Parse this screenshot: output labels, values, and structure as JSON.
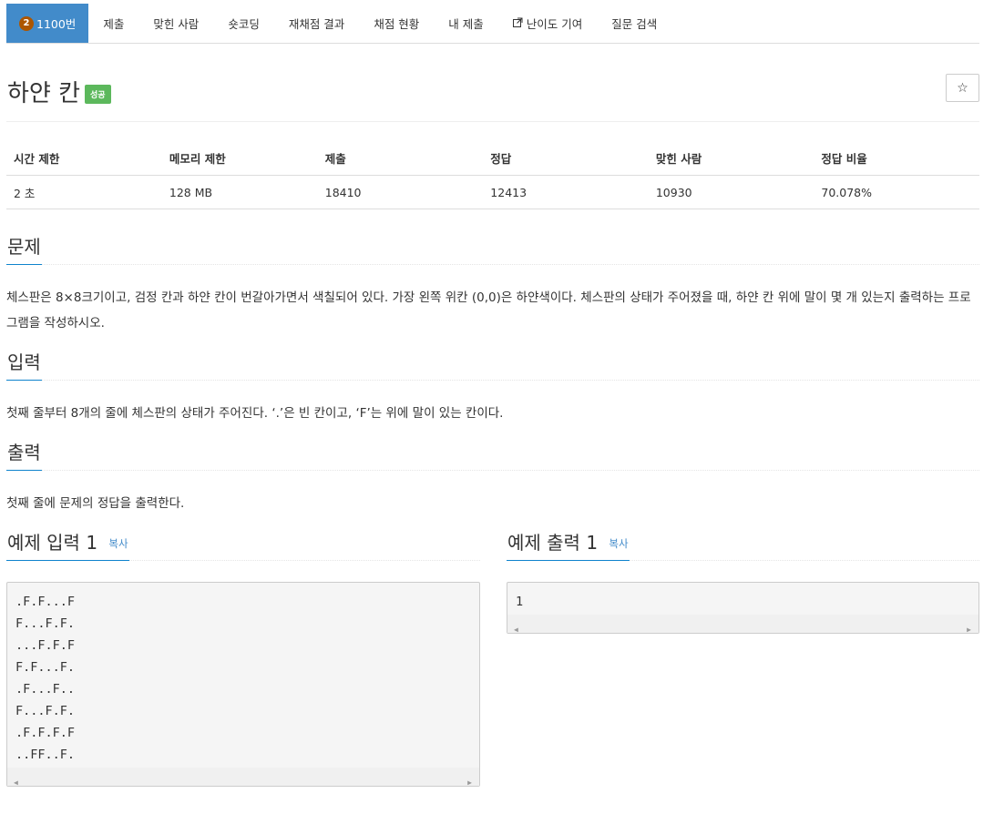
{
  "nav": {
    "problem_number": "1100번",
    "badge": "2",
    "tabs": [
      "제출",
      "맞힌 사람",
      "숏코딩",
      "재채점 결과",
      "채점 현황",
      "내 제출",
      "난이도 기여",
      "질문 검색"
    ]
  },
  "title": "하얀 칸",
  "status_badge": "성공",
  "star": "☆",
  "info_table": {
    "headers": [
      "시간 제한",
      "메모리 제한",
      "제출",
      "정답",
      "맞힌 사람",
      "정답 비율"
    ],
    "values": [
      "2 초",
      "128 MB",
      "18410",
      "12413",
      "10930",
      "70.078%"
    ]
  },
  "sections": {
    "problem": {
      "heading": "문제",
      "text": "체스판은 8×8크기이고, 검정 칸과 하얀 칸이 번갈아가면서 색칠되어 있다. 가장 왼쪽 위칸 (0,0)은 하얀색이다. 체스판의 상태가 주어졌을 때, 하얀 칸 위에 말이 몇 개 있는지 출력하는 프로그램을 작성하시오."
    },
    "input": {
      "heading": "입력",
      "text": "첫째 줄부터 8개의 줄에 체스판의 상태가 주어진다. ‘.’은 빈 칸이고, ‘F’는 위에 말이 있는 칸이다."
    },
    "output": {
      "heading": "출력",
      "text": "첫째 줄에 문제의 정답을 출력한다."
    }
  },
  "samples": {
    "input_heading": "예제 입력 1",
    "output_heading": "예제 출력 1",
    "copy_label": "복사",
    "input_text": ".F.F...F\nF...F.F.\n...F.F.F\nF.F...F.\n.F...F..\nF...F.F.\n.F.F.F.F\n..FF..F.",
    "output_text": "1"
  },
  "colors": {
    "accent": "#428bca",
    "badge_success": "#5cb85c",
    "tier_badge": "#ad5600"
  }
}
